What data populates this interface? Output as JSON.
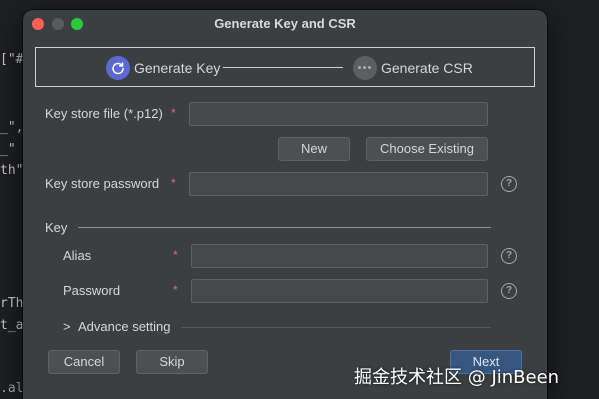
{
  "editor": {
    "line1": "[\"#",
    "line2": "_\",",
    "line3": "_\"",
    "line4": "th\"",
    "line5": "rTh",
    "line6": "t_a",
    "line7": ".alignRules({"
  },
  "dialog": {
    "title": "Generate Key and CSR",
    "steps": [
      {
        "label": "Generate Key",
        "active": true,
        "icon": "refresh-icon"
      },
      {
        "label": "Generate CSR",
        "active": false,
        "icon": "more-dots-icon"
      }
    ],
    "key_store_file": {
      "label": "Key store file (*.p12)",
      "required": "*",
      "value": ""
    },
    "new_button": "New",
    "choose_existing_button": "Choose Existing",
    "key_store_password": {
      "label": "Key store password",
      "required": "*",
      "value": ""
    },
    "key_section": "Key",
    "alias": {
      "label": "Alias",
      "required": "*",
      "value": ""
    },
    "password": {
      "label": "Password",
      "required": "*",
      "value": ""
    },
    "advance_setting": "Advance setting",
    "chevron": ">",
    "help_glyph": "?",
    "cancel_button": "Cancel",
    "skip_button": "Skip",
    "next_button": "Next"
  },
  "watermark": "掘金技术社区 @ JinBeen",
  "colors": {
    "accent": "#5a6ad1",
    "required": "#e06c75",
    "next_button": "#365880"
  }
}
